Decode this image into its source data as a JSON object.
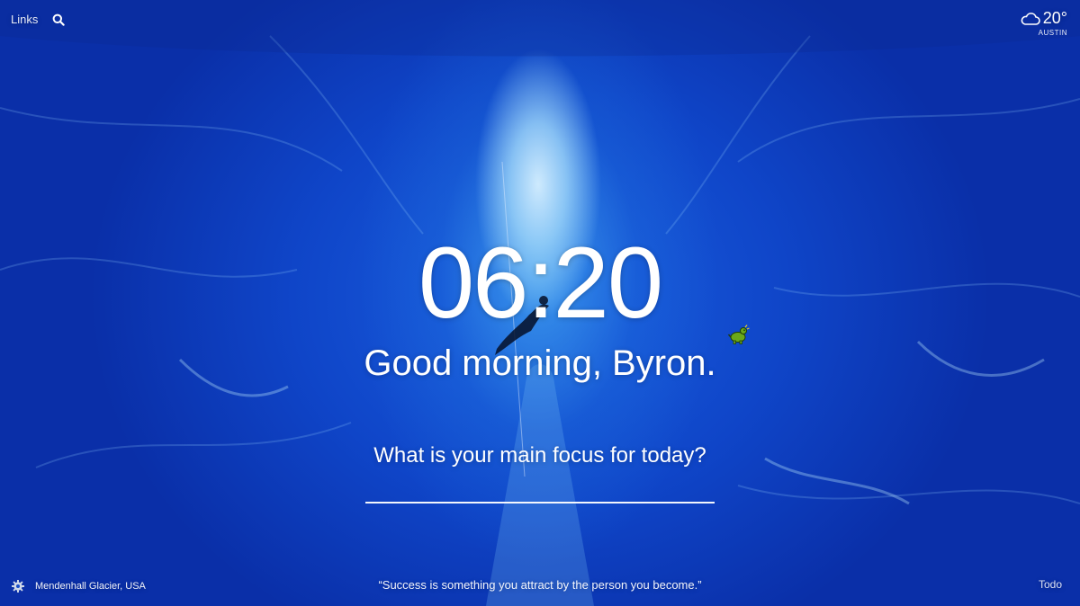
{
  "header": {
    "links_label": "Links",
    "search_icon": "search-icon"
  },
  "weather": {
    "icon": "cloud-icon",
    "temperature": "20°",
    "location": "AUSTIN"
  },
  "main": {
    "time": "06:20",
    "greeting": "Good morning, Byron.",
    "focus_question": "What is your main focus for today?",
    "focus_value": "",
    "mascot_icon": "dinosaur-icon"
  },
  "footer": {
    "settings_icon": "gear-icon",
    "photo_location": "Mendenhall Glacier, USA",
    "quote": "“Success is something you attract by the person you become.”",
    "todo_label": "Todo"
  },
  "colors": {
    "background_deep": "#0a2fa8",
    "background_mid": "#0f45c8",
    "ice_highlight": "#d7f0ff",
    "text": "#ffffff"
  }
}
